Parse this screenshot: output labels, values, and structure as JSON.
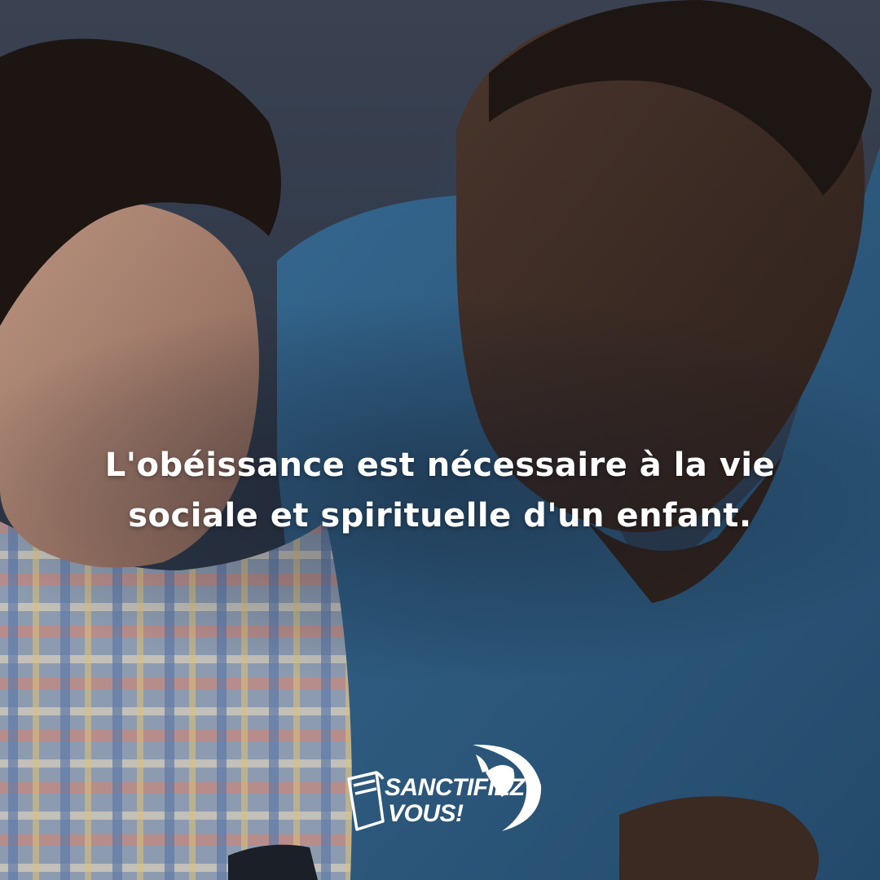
{
  "quote": {
    "line1": "L'obéissance est nécessaire à la vie",
    "line2": "sociale et spirituelle d'un enfant."
  },
  "logo": {
    "line1": "SANCTIFIEZ",
    "line2": "VOUS!",
    "icons": [
      "open-book-icon",
      "dove-icon"
    ]
  },
  "colors": {
    "text": "#ffffff",
    "shirt_blue": "#2d5f86",
    "overlay": "#2b3444"
  }
}
